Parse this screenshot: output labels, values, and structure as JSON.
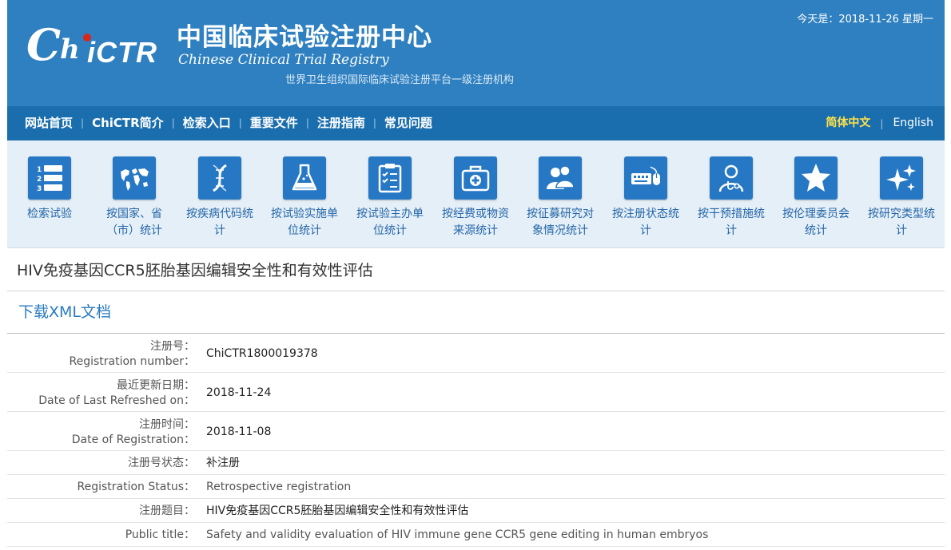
{
  "header": {
    "logo_mark": {
      "c": "C",
      "h": "h",
      "ictr": "iCTR"
    },
    "logo_cn": "中国临床试验注册中心",
    "logo_en": "Chinese Clinical Trial Registry",
    "subtitle": "世界卫生组织国际临床试验注册平台一级注册机构",
    "date_text": "今天是：2018-11-26 星期一"
  },
  "nav": {
    "items": [
      {
        "label": "网站首页"
      },
      {
        "label": "ChiCTR简介"
      },
      {
        "label": "检索入口"
      },
      {
        "label": "重要文件"
      },
      {
        "label": "注册指南"
      },
      {
        "label": "常见问题"
      }
    ],
    "separator": "|",
    "lang_cn": "简体中文",
    "lang_en": "English"
  },
  "icons": [
    {
      "icon": "list-numbered-icon",
      "line1": "检索试验",
      "line2": ""
    },
    {
      "icon": "world-map-icon",
      "line1": "按国家、省",
      "line2": "（市）统计"
    },
    {
      "icon": "dna-icon",
      "line1": "按疾病代码统",
      "line2": "计"
    },
    {
      "icon": "flask-icon",
      "line1": "按试验实施单",
      "line2": "位统计"
    },
    {
      "icon": "clipboard-icon",
      "line1": "按试验主办单",
      "line2": "位统计"
    },
    {
      "icon": "medical-kit-icon",
      "line1": "按经费或物资",
      "line2": "来源统计"
    },
    {
      "icon": "people-icon",
      "line1": "按征募研究对",
      "line2": "象情况统计"
    },
    {
      "icon": "keyboard-mouse-icon",
      "line1": "按注册状态统",
      "line2": "计"
    },
    {
      "icon": "doctor-icon",
      "line1": "按干预措施统",
      "line2": "计"
    },
    {
      "icon": "star-icon",
      "line1": "按伦理委员会",
      "line2": "统计"
    },
    {
      "icon": "sparkle-icon",
      "line1": "按研究类型统",
      "line2": "计"
    }
  ],
  "record": {
    "title": "HIV免疫基因CCR5胚胎基因编辑安全性和有效性评估",
    "xml_link": "下载XML文档",
    "fields": [
      {
        "label_cn": "注册号：",
        "label_en": "Registration number：",
        "value": "ChiCTR1800019378"
      },
      {
        "label_cn": "最近更新日期：",
        "label_en": "Date of Last Refreshed on：",
        "value": "2018-11-24"
      },
      {
        "label_cn": "注册时间：",
        "label_en": "Date of Registration：",
        "value": "2018-11-08"
      },
      {
        "label_cn": "注册号状态：",
        "label_en": "",
        "value": "补注册"
      },
      {
        "label_cn": "Registration Status：",
        "label_en": "",
        "value": "Retrospective registration"
      },
      {
        "label_cn": "注册题目：",
        "label_en": "",
        "value": "HIV免疫基因CCR5胚胎基因编辑安全性和有效性评估"
      },
      {
        "label_cn": "Public title：",
        "label_en": "",
        "value": "Safety and validity evaluation of HIV immune gene CCR5 gene editing in human embryos"
      }
    ]
  }
}
